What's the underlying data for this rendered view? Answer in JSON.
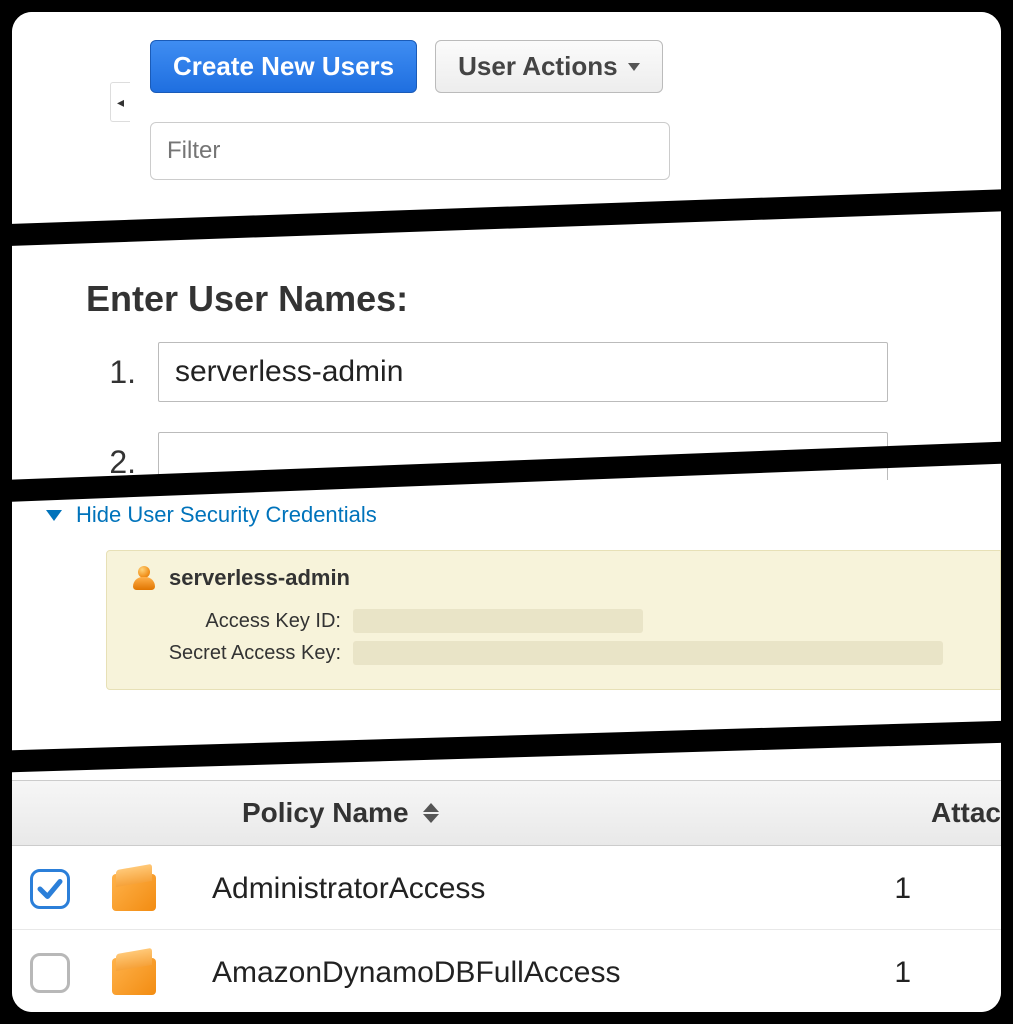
{
  "toolbar": {
    "create_label": "Create New Users",
    "actions_label": "User Actions",
    "filter_placeholder": "Filter"
  },
  "enter_users": {
    "heading": "Enter User Names:",
    "rows": [
      {
        "num": "1.",
        "value": "serverless-admin"
      },
      {
        "num": "2.",
        "value": ""
      }
    ]
  },
  "credentials": {
    "toggle_label": "Hide User Security Credentials",
    "username": "serverless-admin",
    "access_key_label": "Access Key ID:",
    "secret_key_label": "Secret Access Key:"
  },
  "policies": {
    "header_policy": "Policy Name",
    "header_attached": "Attac",
    "rows": [
      {
        "checked": true,
        "name": "AdministratorAccess",
        "count": "1"
      },
      {
        "checked": false,
        "name": "AmazonDynamoDBFullAccess",
        "count": "1"
      }
    ]
  }
}
